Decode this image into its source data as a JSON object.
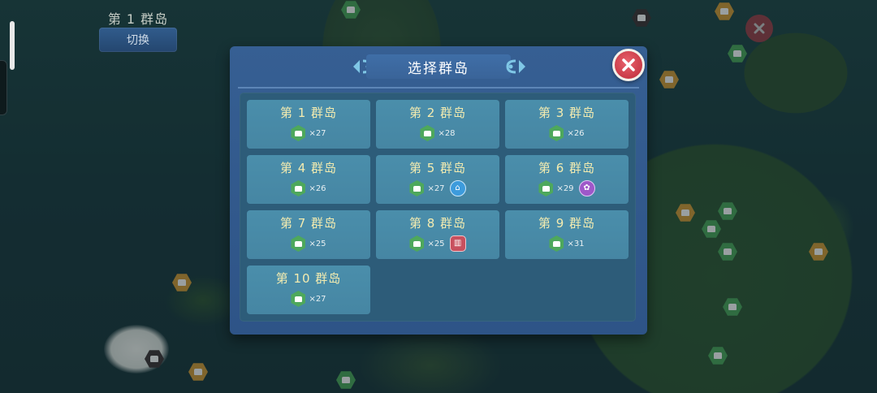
{
  "header": {
    "current_group": "第 1 群岛",
    "switch_label": "切换"
  },
  "dialog": {
    "title": "选择群岛"
  },
  "groups": [
    {
      "name": "第 1 群岛",
      "count": "×27"
    },
    {
      "name": "第 2 群岛",
      "count": "×28"
    },
    {
      "name": "第 3 群岛",
      "count": "×26"
    },
    {
      "name": "第 4 群岛",
      "count": "×26"
    },
    {
      "name": "第 5 群岛",
      "count": "×27",
      "extra_icon": "home-icon"
    },
    {
      "name": "第 6 群岛",
      "count": "×29",
      "extra_icon": "creature-icon"
    },
    {
      "name": "第 7 群岛",
      "count": "×25"
    },
    {
      "name": "第 8 群岛",
      "count": "×25",
      "extra_icon": "shrine-icon"
    },
    {
      "name": "第 9 群岛",
      "count": "×31"
    },
    {
      "name": "第 10 群岛",
      "count": "×27"
    }
  ],
  "icons": {
    "teleport": "teleport-statue-icon",
    "close": "close-icon"
  },
  "colors": {
    "dialog": "#2e5487",
    "card": "#4686a3",
    "card_title": "#f4ecb0",
    "close_button": "#c93a47",
    "teleport_badge": "#4ea85c"
  }
}
